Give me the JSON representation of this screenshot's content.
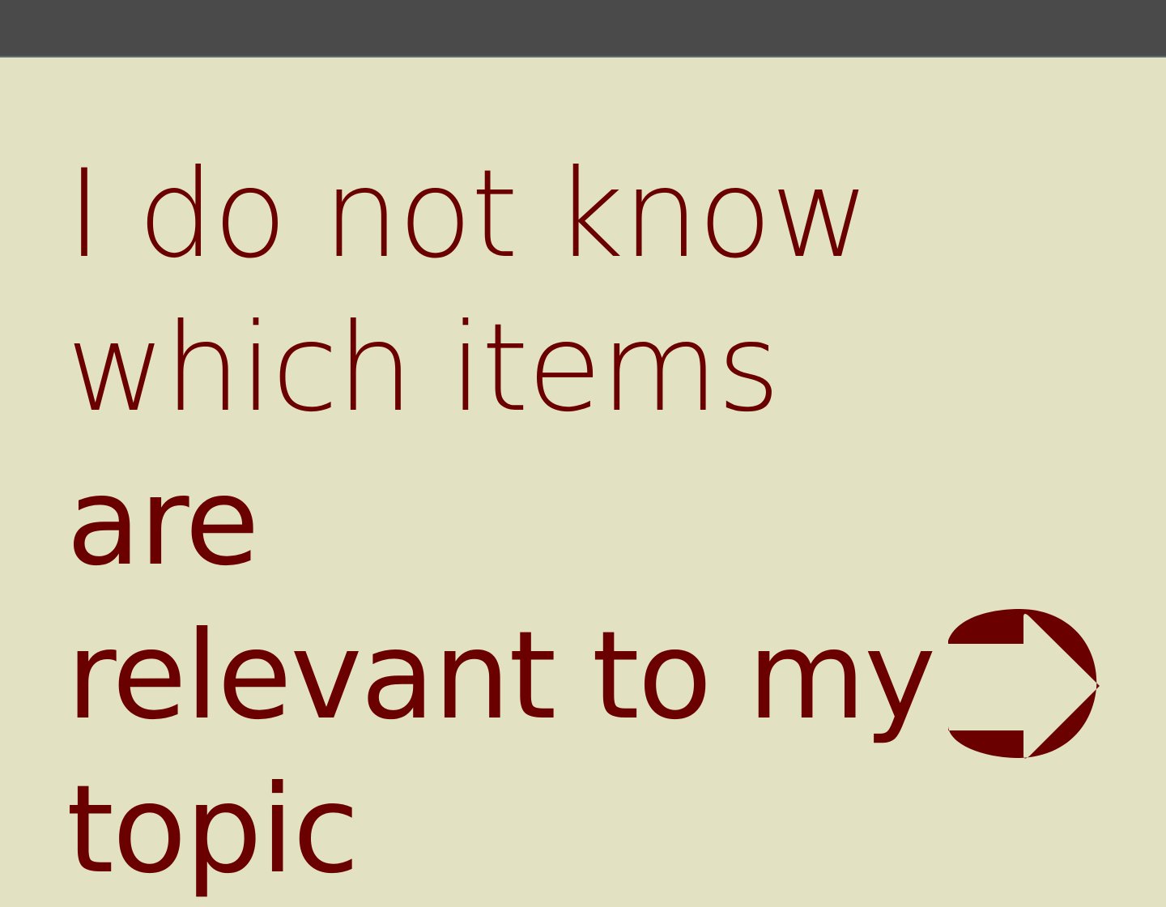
{
  "header": {
    "bar_color": "#4a4a4a"
  },
  "message": {
    "line1": "I do not know",
    "line2a": "which items ",
    "line2b": "are",
    "line3": "relevant to my",
    "line4": "topic"
  },
  "next_button": {
    "icon": "circle-right-arrow-icon",
    "color": "#6b0000"
  },
  "colors": {
    "background": "#e2e2c2",
    "text": "#6b0000"
  }
}
